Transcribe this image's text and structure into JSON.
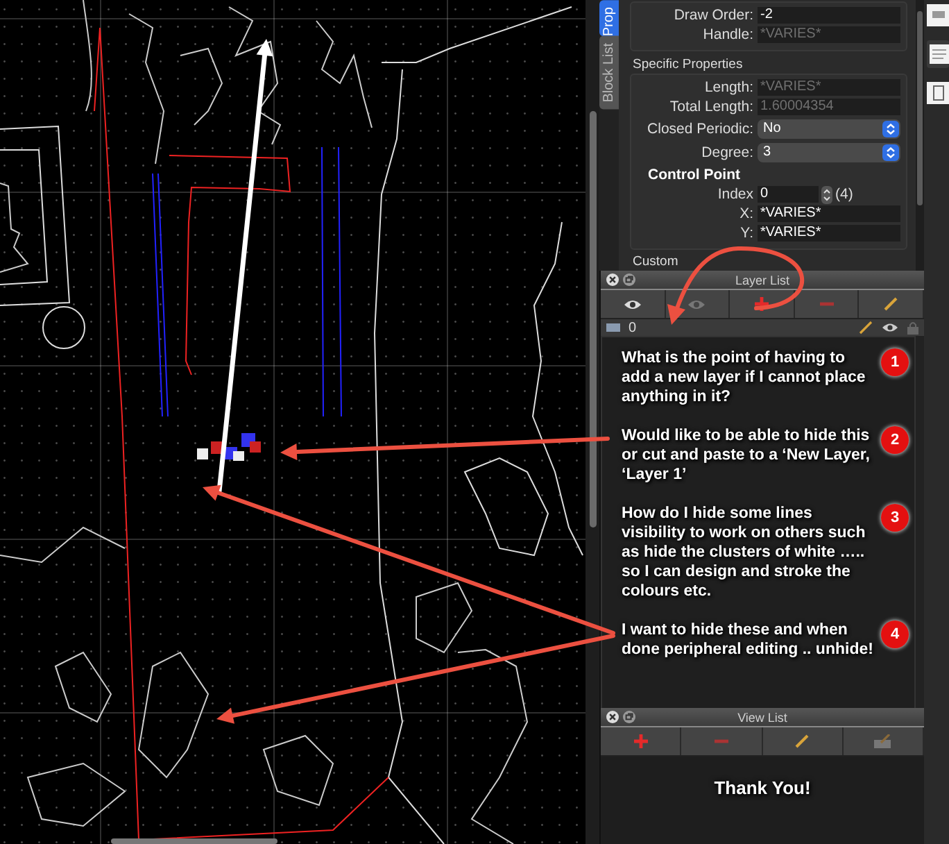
{
  "properties_panel": {
    "tabs": [
      {
        "label": "Prop",
        "selected": true
      },
      {
        "label": "Block List",
        "selected": false
      }
    ],
    "general_rows": [
      {
        "label": "Draw Order:",
        "value": "-2",
        "disabled": false
      },
      {
        "label": "Handle:",
        "value": "*VARIES*",
        "disabled": true
      }
    ],
    "specific_properties": {
      "heading": "Specific Properties",
      "rows": [
        {
          "kind": "field",
          "label": "Length:",
          "value": "*VARIES*",
          "disabled": true
        },
        {
          "kind": "field",
          "label": "Total Length:",
          "value": "1.60004354",
          "disabled": true
        },
        {
          "kind": "dropdown",
          "label": "Closed Periodic:",
          "value": "No",
          "disabled": false
        },
        {
          "kind": "dropdown",
          "label": "Degree:",
          "value": "3",
          "disabled": false
        }
      ],
      "control_point": {
        "heading": "Control Point",
        "index_label": "Index",
        "index_value": "0",
        "count": "(4)",
        "rows": [
          {
            "label": "X:",
            "value": "*VARIES*",
            "disabled": false
          },
          {
            "label": "Y:",
            "value": "*VARIES*",
            "disabled": false
          }
        ]
      }
    },
    "next_heading": "Custom"
  },
  "layer_list": {
    "title": "Layer List",
    "tools": [
      {
        "kind": "eye"
      },
      {
        "kind": "eye-dim"
      },
      {
        "kind": "add"
      },
      {
        "kind": "remove"
      },
      {
        "kind": "edit"
      }
    ],
    "layers": [
      {
        "name": "0"
      }
    ]
  },
  "notes": [
    {
      "number": "1",
      "text": "What is the point of having to add a new layer if I cannot place anything in it?"
    },
    {
      "number": "2",
      "text": "Would like to be able to hide this or cut and paste to a ‘New Layer, ‘Layer 1’"
    },
    {
      "number": "3",
      "text": "How do I hide some lines visibility to work on others such as hide the clusters of white ….. so I can design and stroke the colours etc."
    },
    {
      "number": "4",
      "text": "I want to hide these and when done peripheral editing .. unhide!"
    }
  ],
  "view_list": {
    "title": "View List",
    "tools": [
      {
        "kind": "add"
      },
      {
        "kind": "remove"
      },
      {
        "kind": "edit"
      },
      {
        "kind": "edit-box"
      }
    ],
    "message": "Thank You!"
  }
}
